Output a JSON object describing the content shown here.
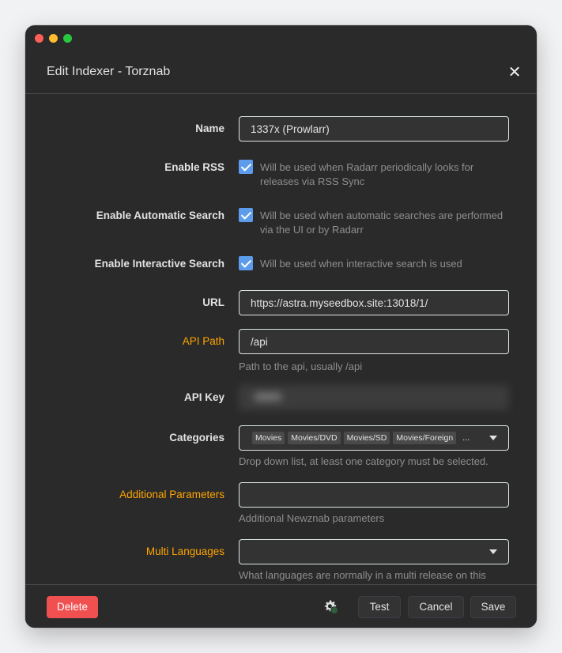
{
  "modal": {
    "title": "Edit Indexer - Torznab"
  },
  "fields": {
    "name": {
      "label": "Name",
      "value": "1337x (Prowlarr)"
    },
    "enable_rss": {
      "label": "Enable RSS",
      "help": "Will be used when Radarr periodically looks for releases via RSS Sync",
      "checked": true
    },
    "enable_auto": {
      "label": "Enable Automatic Search",
      "help": "Will be used when automatic searches are performed via the UI or by Radarr",
      "checked": true
    },
    "enable_interactive": {
      "label": "Enable Interactive Search",
      "help": "Will be used when interactive search is used",
      "checked": true
    },
    "url": {
      "label": "URL",
      "value": "https://astra.myseedbox.site:13018/1/"
    },
    "api_path": {
      "label": "API Path",
      "value": "/api",
      "help": "Path to the api, usually /api"
    },
    "api_key": {
      "label": "API Key"
    },
    "categories": {
      "label": "Categories",
      "tags": [
        "Movies",
        "Movies/DVD",
        "Movies/SD",
        "Movies/Foreign"
      ],
      "more": "...",
      "help": "Drop down list, at least one category must be selected."
    },
    "additional": {
      "label": "Additional Parameters",
      "value": "",
      "help": "Additional Newznab parameters"
    },
    "multi_lang": {
      "label": "Multi Languages",
      "value": "",
      "help": "What languages are normally in a multi release on this"
    }
  },
  "footer": {
    "delete": "Delete",
    "test": "Test",
    "cancel": "Cancel",
    "save": "Save"
  },
  "colors": {
    "accent": "#5d9cec",
    "warning": "#ffa500",
    "danger": "#f05050",
    "background": "#2a2a2a"
  }
}
